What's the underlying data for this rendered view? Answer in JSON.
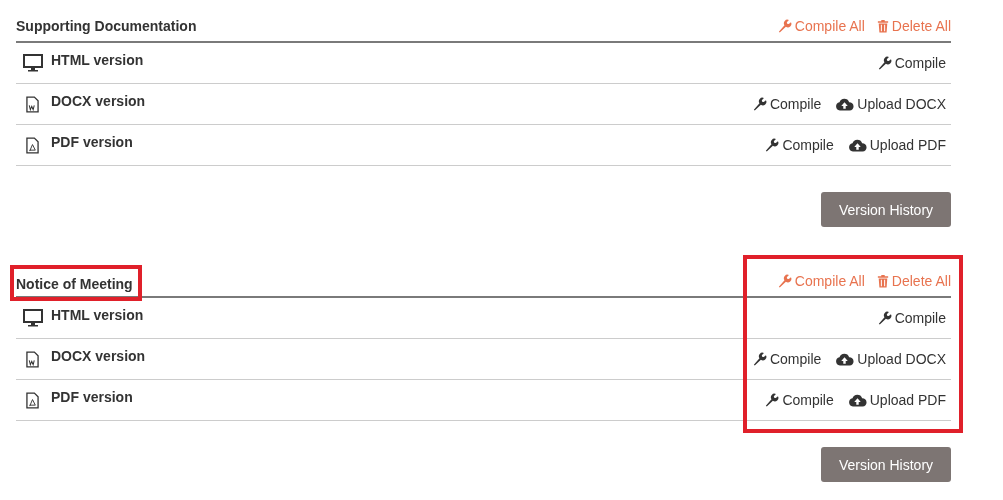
{
  "sections": [
    {
      "title": "Supporting Documentation",
      "title_highlighted": false,
      "actions_highlighted": false,
      "header_actions": [
        {
          "kind": "compile",
          "label": "Compile All"
        },
        {
          "kind": "delete",
          "label": "Delete All"
        }
      ],
      "rows": [
        {
          "kind": "monitor",
          "label": "HTML version",
          "actions": [
            {
              "kind": "compile",
              "label": "Compile"
            }
          ]
        },
        {
          "kind": "docx",
          "label": "DOCX version",
          "actions": [
            {
              "kind": "compile",
              "label": "Compile"
            },
            {
              "kind": "upload",
              "label": "Upload DOCX"
            }
          ]
        },
        {
          "kind": "pdf",
          "label": "PDF version",
          "actions": [
            {
              "kind": "compile",
              "label": "Compile"
            },
            {
              "kind": "upload",
              "label": "Upload PDF"
            }
          ]
        }
      ],
      "button": "Version History"
    },
    {
      "title": "Notice of Meeting",
      "title_highlighted": true,
      "actions_highlighted": true,
      "header_actions": [
        {
          "kind": "compile",
          "label": "Compile All"
        },
        {
          "kind": "delete",
          "label": "Delete All"
        }
      ],
      "rows": [
        {
          "kind": "monitor",
          "label": "HTML version",
          "actions": [
            {
              "kind": "compile",
              "label": "Compile"
            }
          ]
        },
        {
          "kind": "docx",
          "label": "DOCX version",
          "actions": [
            {
              "kind": "compile",
              "label": "Compile"
            },
            {
              "kind": "upload",
              "label": "Upload DOCX"
            }
          ]
        },
        {
          "kind": "pdf",
          "label": "PDF version",
          "actions": [
            {
              "kind": "compile",
              "label": "Compile"
            },
            {
              "kind": "upload",
              "label": "Upload PDF"
            }
          ]
        }
      ],
      "button": "Version History"
    }
  ]
}
